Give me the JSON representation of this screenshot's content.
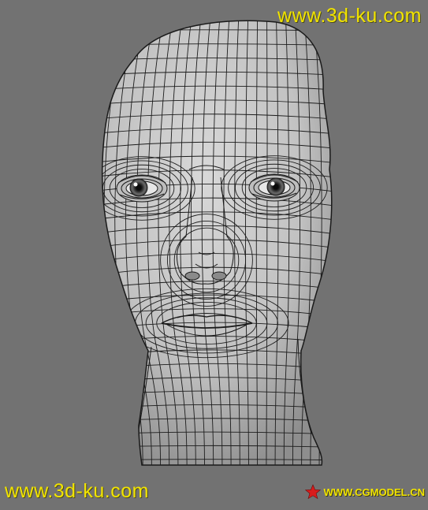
{
  "watermark_top": "www.3d-ku.com",
  "watermark_bottom": "www.3d-ku.com",
  "watermark_logo": "WWW.CGMODEL.CN",
  "icons": {
    "logo": "red-star-icon"
  },
  "colors": {
    "background": "#727272",
    "mesh_fill": "#c9c9c9",
    "wire": "#1a1a1a",
    "watermark": "#f2e400",
    "star": "#d91c1c"
  }
}
